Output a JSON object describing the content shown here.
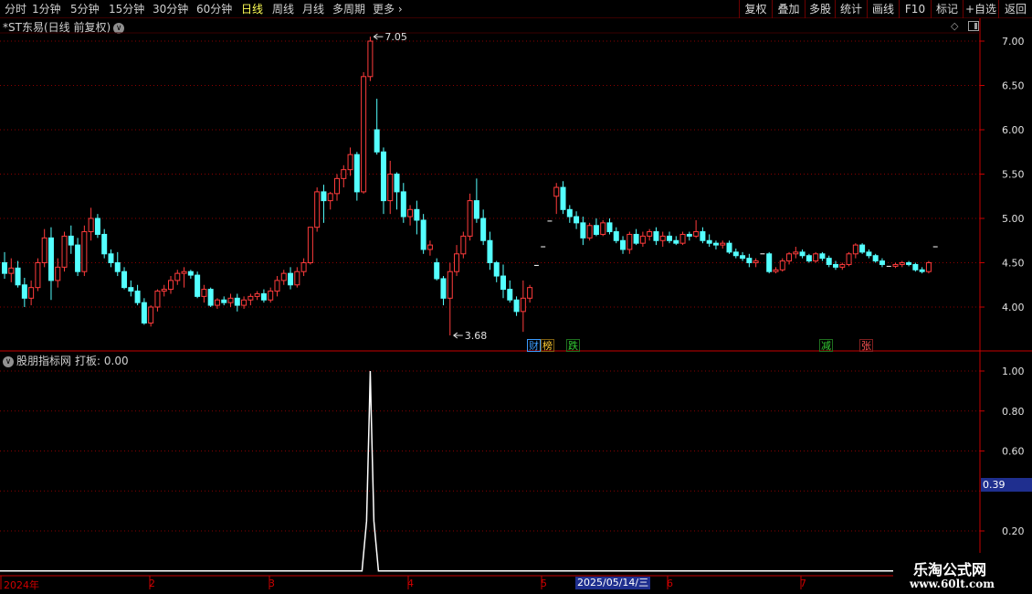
{
  "toolbar": {
    "periods": [
      {
        "label": "分时",
        "active": false
      },
      {
        "label": "1分钟",
        "active": false
      },
      {
        "label": "5分钟",
        "active": false
      },
      {
        "label": "15分钟",
        "active": false
      },
      {
        "label": "30分钟",
        "active": false
      },
      {
        "label": "60分钟",
        "active": false
      },
      {
        "label": "日线",
        "active": true
      },
      {
        "label": "周线",
        "active": false
      },
      {
        "label": "月线",
        "active": false
      },
      {
        "label": "多周期",
        "active": false
      },
      {
        "label": "更多",
        "active": false
      }
    ],
    "more_icon": "chevron-right-icon",
    "buttons": [
      "复权",
      "叠加",
      "多股",
      "统计",
      "画线",
      "F10",
      "标记",
      "+自选",
      "返回"
    ]
  },
  "main_panel": {
    "title": "*ST东易(日线 前复权)",
    "dropdown_icon": "chevron-down-icon",
    "corner_icons": [
      "diamond-icon",
      "panel-toggle-icon"
    ],
    "y_axis_ticks": [
      "7.00",
      "6.50",
      "6.00",
      "5.50",
      "5.00",
      "4.50",
      "4.00"
    ],
    "high_label": "7.05",
    "low_label": "3.68",
    "event_markers": [
      {
        "text": "财",
        "color": "#3b9cff"
      },
      {
        "text": "榜",
        "color": "#ffcc33"
      },
      {
        "text": "跌",
        "color": "#33cc33"
      },
      {
        "text": "减",
        "color": "#33cc33"
      },
      {
        "text": "张",
        "color": "#ff5555"
      }
    ]
  },
  "indicator_panel": {
    "title": "股朋指标网",
    "value_label": "打板: 0.00",
    "dropdown_icon": "chevron-down-icon",
    "y_axis_ticks": [
      "1.00",
      "0.80",
      "0.60",
      "0.20"
    ],
    "cursor_value": "0.39"
  },
  "time_axis": {
    "labels": [
      "2024年",
      "2",
      "3",
      "4",
      "5",
      "6",
      "7"
    ],
    "cursor_date": "2025/05/14/三"
  },
  "watermark": {
    "title": "乐淘公式网",
    "url": "www.60lt.com"
  },
  "colors": {
    "up": "#ff3c3c",
    "down": "#54ffff",
    "grid": "#8a0000",
    "axis": "#c80000",
    "signal": "#ffffff"
  },
  "chart_data": {
    "type": "candlestick",
    "y_range": [
      3.5,
      7.2
    ],
    "candles": [
      [
        4.5,
        4.62,
        4.32,
        4.38
      ],
      [
        4.38,
        4.55,
        4.28,
        4.44
      ],
      [
        4.44,
        4.52,
        4.22,
        4.25
      ],
      [
        4.25,
        4.33,
        4.0,
        4.1
      ],
      [
        4.1,
        4.3,
        4.02,
        4.22
      ],
      [
        4.22,
        4.55,
        4.18,
        4.5
      ],
      [
        4.5,
        4.88,
        4.45,
        4.78
      ],
      [
        4.78,
        4.9,
        4.08,
        4.3
      ],
      [
        4.3,
        4.55,
        4.22,
        4.45
      ],
      [
        4.45,
        4.85,
        4.4,
        4.8
      ],
      [
        4.8,
        4.92,
        4.6,
        4.7
      ],
      [
        4.7,
        4.78,
        4.35,
        4.4
      ],
      [
        4.4,
        4.92,
        4.35,
        4.85
      ],
      [
        4.85,
        5.12,
        4.75,
        5.0
      ],
      [
        5.0,
        5.05,
        4.78,
        4.82
      ],
      [
        4.82,
        4.88,
        4.55,
        4.6
      ],
      [
        4.6,
        4.65,
        4.45,
        4.5
      ],
      [
        4.5,
        4.62,
        4.35,
        4.4
      ],
      [
        4.4,
        4.45,
        4.2,
        4.22
      ],
      [
        4.22,
        4.3,
        4.12,
        4.18
      ],
      [
        4.18,
        4.25,
        4.02,
        4.05
      ],
      [
        4.05,
        4.1,
        3.8,
        3.82
      ],
      [
        3.82,
        4.02,
        3.78,
        4.0
      ],
      [
        4.0,
        4.2,
        3.95,
        4.18
      ],
      [
        4.18,
        4.25,
        4.12,
        4.2
      ],
      [
        4.2,
        4.35,
        4.15,
        4.3
      ],
      [
        4.3,
        4.42,
        4.25,
        4.38
      ],
      [
        4.38,
        4.45,
        4.22,
        4.4
      ],
      [
        4.4,
        4.42,
        4.32,
        4.36
      ],
      [
        4.36,
        4.4,
        4.1,
        4.12
      ],
      [
        4.12,
        4.25,
        4.05,
        4.2
      ],
      [
        4.2,
        4.22,
        4.0,
        4.02
      ],
      [
        4.02,
        4.1,
        3.98,
        4.08
      ],
      [
        4.08,
        4.12,
        4.02,
        4.05
      ],
      [
        4.05,
        4.15,
        4.0,
        4.1
      ],
      [
        4.1,
        4.15,
        3.95,
        4.02
      ],
      [
        4.02,
        4.12,
        3.98,
        4.08
      ],
      [
        4.08,
        4.15,
        4.02,
        4.12
      ],
      [
        4.12,
        4.18,
        4.08,
        4.15
      ],
      [
        4.15,
        4.2,
        4.05,
        4.08
      ],
      [
        4.08,
        4.22,
        4.05,
        4.18
      ],
      [
        4.18,
        4.35,
        4.12,
        4.3
      ],
      [
        4.3,
        4.42,
        4.25,
        4.38
      ],
      [
        4.38,
        4.45,
        4.2,
        4.25
      ],
      [
        4.25,
        4.45,
        4.22,
        4.4
      ],
      [
        4.4,
        4.55,
        4.35,
        4.5
      ],
      [
        4.5,
        4.9,
        4.48,
        4.9
      ],
      [
        4.9,
        5.35,
        4.85,
        5.3
      ],
      [
        5.3,
        5.38,
        4.95,
        5.2
      ],
      [
        5.2,
        5.3,
        5.1,
        5.28
      ],
      [
        5.28,
        5.5,
        5.2,
        5.45
      ],
      [
        5.45,
        5.6,
        5.35,
        5.55
      ],
      [
        5.55,
        5.8,
        5.48,
        5.72
      ],
      [
        5.72,
        5.75,
        5.2,
        5.3
      ],
      [
        5.3,
        6.65,
        5.28,
        6.6
      ],
      [
        6.6,
        7.05,
        6.55,
        7.0
      ],
      [
        6.0,
        6.35,
        5.72,
        5.75
      ],
      [
        5.75,
        5.8,
        5.05,
        5.2
      ],
      [
        5.2,
        5.65,
        5.05,
        5.5
      ],
      [
        5.5,
        5.52,
        5.1,
        5.3
      ],
      [
        5.3,
        5.4,
        4.95,
        5.02
      ],
      [
        5.02,
        5.15,
        4.92,
        5.1
      ],
      [
        5.1,
        5.2,
        4.82,
        4.98
      ],
      [
        4.98,
        5.05,
        4.6,
        4.65
      ],
      [
        4.65,
        4.75,
        4.58,
        4.7
      ],
      [
        4.5,
        4.55,
        4.3,
        4.32
      ],
      [
        4.32,
        4.35,
        4.02,
        4.1
      ],
      [
        4.1,
        4.5,
        3.68,
        4.4
      ],
      [
        4.4,
        4.7,
        4.35,
        4.6
      ],
      [
        4.6,
        4.85,
        4.55,
        4.8
      ],
      [
        4.8,
        5.28,
        4.75,
        5.2
      ],
      [
        5.2,
        5.45,
        4.95,
        5.0
      ],
      [
        5.0,
        5.1,
        4.7,
        4.75
      ],
      [
        4.75,
        4.85,
        4.42,
        4.5
      ],
      [
        4.5,
        4.52,
        4.28,
        4.35
      ],
      [
        4.35,
        4.48,
        4.1,
        4.2
      ],
      [
        4.2,
        4.3,
        4.05,
        4.08
      ],
      [
        4.08,
        4.12,
        3.9,
        3.95
      ],
      [
        3.95,
        4.3,
        3.72,
        4.1
      ],
      [
        4.1,
        4.25,
        4.05,
        4.22
      ],
      [
        4.47,
        4.49,
        4.45,
        4.47
      ],
      [
        4.68,
        4.7,
        4.66,
        4.68
      ],
      [
        4.97,
        4.99,
        4.95,
        4.97
      ],
      [
        5.25,
        5.4,
        5.05,
        5.35
      ],
      [
        5.35,
        5.42,
        5.05,
        5.1
      ],
      [
        5.1,
        5.15,
        4.95,
        5.02
      ],
      [
        5.02,
        5.08,
        4.88,
        4.95
      ],
      [
        4.95,
        5.02,
        4.7,
        4.78
      ],
      [
        4.78,
        4.95,
        4.75,
        4.92
      ],
      [
        4.92,
        5.0,
        4.8,
        4.82
      ],
      [
        4.82,
        4.98,
        4.8,
        4.95
      ],
      [
        4.95,
        5.0,
        4.82,
        4.85
      ],
      [
        4.85,
        4.9,
        4.72,
        4.75
      ],
      [
        4.75,
        4.8,
        4.6,
        4.65
      ],
      [
        4.65,
        4.85,
        4.6,
        4.82
      ],
      [
        4.82,
        4.88,
        4.7,
        4.72
      ],
      [
        4.72,
        4.85,
        4.68,
        4.8
      ],
      [
        4.8,
        4.88,
        4.75,
        4.85
      ],
      [
        4.85,
        4.9,
        4.7,
        4.75
      ],
      [
        4.75,
        4.85,
        4.68,
        4.8
      ],
      [
        4.8,
        4.85,
        4.72,
        4.75
      ],
      [
        4.75,
        4.8,
        4.7,
        4.72
      ],
      [
        4.72,
        4.85,
        4.7,
        4.82
      ],
      [
        4.82,
        4.85,
        4.75,
        4.8
      ],
      [
        4.8,
        4.98,
        4.78,
        4.85
      ],
      [
        4.85,
        4.9,
        4.72,
        4.75
      ],
      [
        4.75,
        4.82,
        4.68,
        4.72
      ],
      [
        4.72,
        4.75,
        4.65,
        4.7
      ],
      [
        4.7,
        4.75,
        4.66,
        4.72
      ],
      [
        4.72,
        4.75,
        4.6,
        4.62
      ],
      [
        4.62,
        4.66,
        4.55,
        4.58
      ],
      [
        4.58,
        4.62,
        4.52,
        4.55
      ],
      [
        4.55,
        4.6,
        4.45,
        4.5
      ],
      [
        4.5,
        4.55,
        4.45,
        4.52
      ],
      [
        4.6,
        4.62,
        4.58,
        4.6
      ],
      [
        4.6,
        4.62,
        4.38,
        4.4
      ],
      [
        4.4,
        4.45,
        4.38,
        4.42
      ],
      [
        4.42,
        4.55,
        4.4,
        4.52
      ],
      [
        4.52,
        4.62,
        4.48,
        4.6
      ],
      [
        4.6,
        4.68,
        4.55,
        4.62
      ],
      [
        4.62,
        4.65,
        4.55,
        4.58
      ],
      [
        4.58,
        4.6,
        4.5,
        4.52
      ],
      [
        4.52,
        4.62,
        4.5,
        4.6
      ],
      [
        4.6,
        4.62,
        4.52,
        4.55
      ],
      [
        4.55,
        4.58,
        4.45,
        4.48
      ],
      [
        4.48,
        4.52,
        4.42,
        4.45
      ],
      [
        4.45,
        4.5,
        4.42,
        4.48
      ],
      [
        4.48,
        4.62,
        4.46,
        4.6
      ],
      [
        4.6,
        4.72,
        4.55,
        4.7
      ],
      [
        4.7,
        4.72,
        4.6,
        4.62
      ],
      [
        4.62,
        4.65,
        4.55,
        4.58
      ],
      [
        4.58,
        4.6,
        4.5,
        4.52
      ],
      [
        4.52,
        4.55,
        4.45,
        4.48
      ],
      [
        4.48,
        4.5,
        4.45,
        4.46
      ],
      [
        4.46,
        4.5,
        4.44,
        4.48
      ],
      [
        4.48,
        4.52,
        4.45,
        4.5
      ],
      [
        4.5,
        4.52,
        4.46,
        4.48
      ],
      [
        4.48,
        4.5,
        4.4,
        4.42
      ],
      [
        4.42,
        4.45,
        4.38,
        4.4
      ],
      [
        4.4,
        4.52,
        4.38,
        4.5
      ],
      [
        4.68,
        4.7,
        4.66,
        4.68
      ]
    ],
    "indicator": {
      "name": "打板",
      "y_range": [
        0.0,
        1.05
      ],
      "spike_index": 55,
      "spike_value": 1.0,
      "baseline": 0.0
    }
  }
}
